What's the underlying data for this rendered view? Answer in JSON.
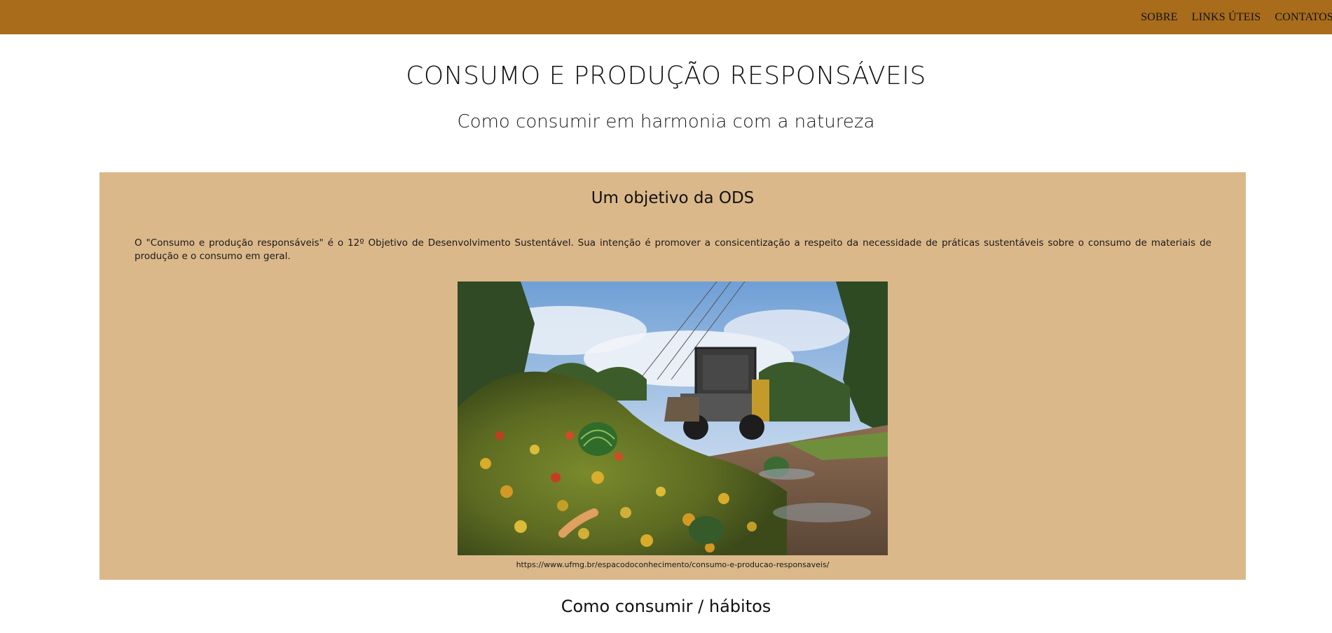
{
  "nav": {
    "items": [
      {
        "label": "SOBRE"
      },
      {
        "label": "LINKS ÚTEIS"
      },
      {
        "label": "CONTATOS"
      }
    ]
  },
  "hero": {
    "title": "CONSUMO E PRODUÇÃO RESPONSÁVEIS",
    "subtitle": "Como consumir em harmonia com a natureza"
  },
  "section_ods": {
    "heading": "Um objetivo da ODS",
    "paragraph": "O \"Consumo e produção responsáveis\" é o 12º Objetivo de Desenvolvimento Sustentável. Sua intenção é promover a consicentização a respeito da necessidade de práticas sustentáveis sobre o consumo de materiais de produção e o consumo em geral.",
    "image_caption": "https://www.ufmg.br/espacodoconhecimento/consumo-e-producao-responsaveis/"
  },
  "section_habits": {
    "heading": "Como consumir / hábitos"
  },
  "colors": {
    "topbar": "#a86c1b",
    "card": "#dbb88a",
    "text": "#111111"
  }
}
